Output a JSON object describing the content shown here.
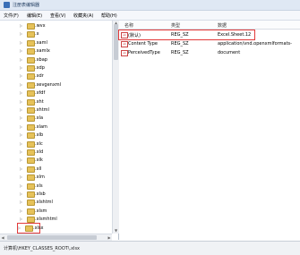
{
  "window": {
    "title": "注册表编辑器"
  },
  "menu": [
    "文件(F)",
    "编辑(E)",
    "查看(V)",
    "收藏夹(A)",
    "帮助(H)"
  ],
  "tree": {
    "items": [
      ".wvx",
      ".x",
      ".xaml",
      ".xamlx",
      ".xbap",
      ".xdp",
      ".xdr",
      ".xevgenxml",
      ".xfdf",
      ".xht",
      ".xhtml",
      ".xla",
      ".xlam",
      ".xlb",
      ".xlc",
      ".xld",
      ".xlk",
      ".xll",
      ".xlm",
      ".xls",
      ".xlsb",
      ".xlshtml",
      ".xlsm",
      ".xlsmhtml",
      ".xlsx"
    ],
    "selected": ".xlsx"
  },
  "values": {
    "headers": [
      "名称",
      "类型",
      "数据"
    ],
    "rows": [
      {
        "name": "(默认)",
        "type": "REG_SZ",
        "data": "Excel.Sheet.12"
      },
      {
        "name": "Content Type",
        "type": "REG_SZ",
        "data": "application/vnd.openxmlformats-"
      },
      {
        "name": "PerceivedType",
        "type": "REG_SZ",
        "data": "document"
      }
    ]
  },
  "status": {
    "path": "计算机\\HKEY_CLASSES_ROOT\\.xlsx"
  }
}
